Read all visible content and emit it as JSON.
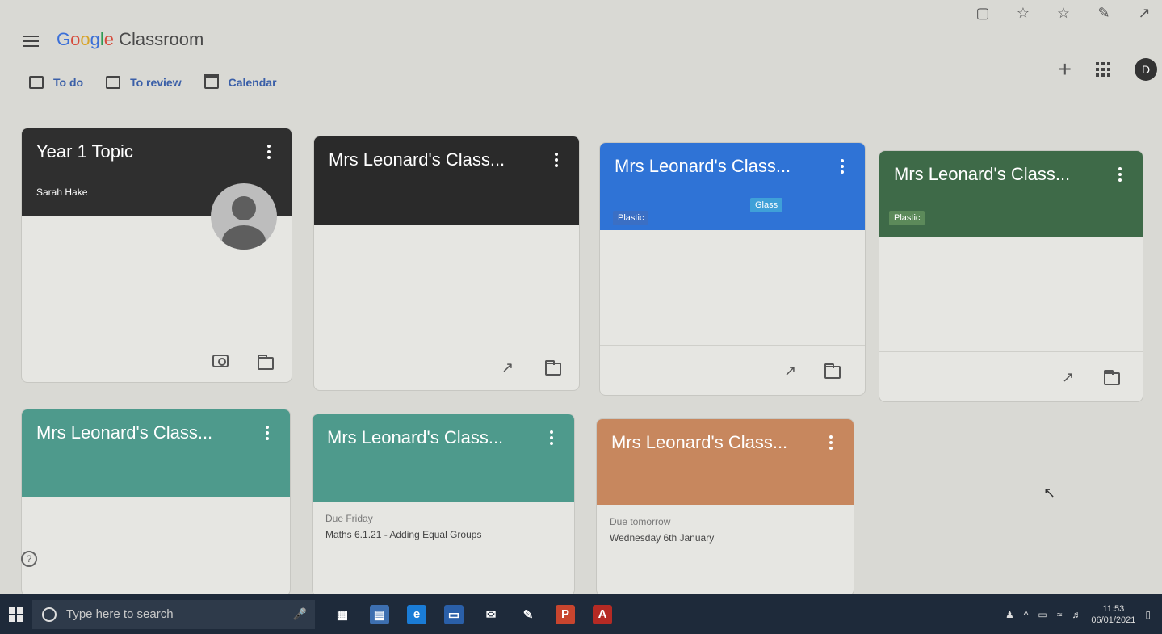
{
  "app": {
    "brand_google": "Google",
    "brand_product": "Classroom"
  },
  "browser": {
    "icons": [
      "reader-icon",
      "star-icon",
      "favorites-icon",
      "pen-icon",
      "share-icon"
    ]
  },
  "header": {
    "plus_label": "+",
    "avatar_letter": "D"
  },
  "nav": {
    "todo": "To do",
    "review": "To review",
    "calendar": "Calendar"
  },
  "cards": [
    {
      "title": "Year 1 Topic",
      "subtitle": "Sarah Hake",
      "banner_color": "#2f2f2f"
    },
    {
      "title": "Mrs Leonard's Class...",
      "banner_color": "#2a2a2a"
    },
    {
      "title": "Mrs Leonard's Class...",
      "banner_color": "#2f73d6",
      "tags": [
        "Plastic",
        "Glass"
      ]
    },
    {
      "title": "Mrs Leonard's Class...",
      "banner_color": "#3e6a48",
      "tags": [
        "Plastic"
      ]
    },
    {
      "title": "Mrs Leonard's Class...",
      "banner_color": "#4e9a8c"
    },
    {
      "title": "Mrs Leonard's Class...",
      "banner_color": "#4e9a8c",
      "due_label": "Due Friday",
      "due_text": "Maths 6.1.21 - Adding Equal Groups"
    },
    {
      "title": "Mrs Leonard's Class...",
      "banner_color": "#c7875e",
      "due_label": "Due tomorrow",
      "due_text": "Wednesday 6th January"
    }
  ],
  "help_label": "?",
  "taskbar": {
    "search_placeholder": "Type here to search",
    "time": "11:53",
    "date": "06/01/2021"
  }
}
